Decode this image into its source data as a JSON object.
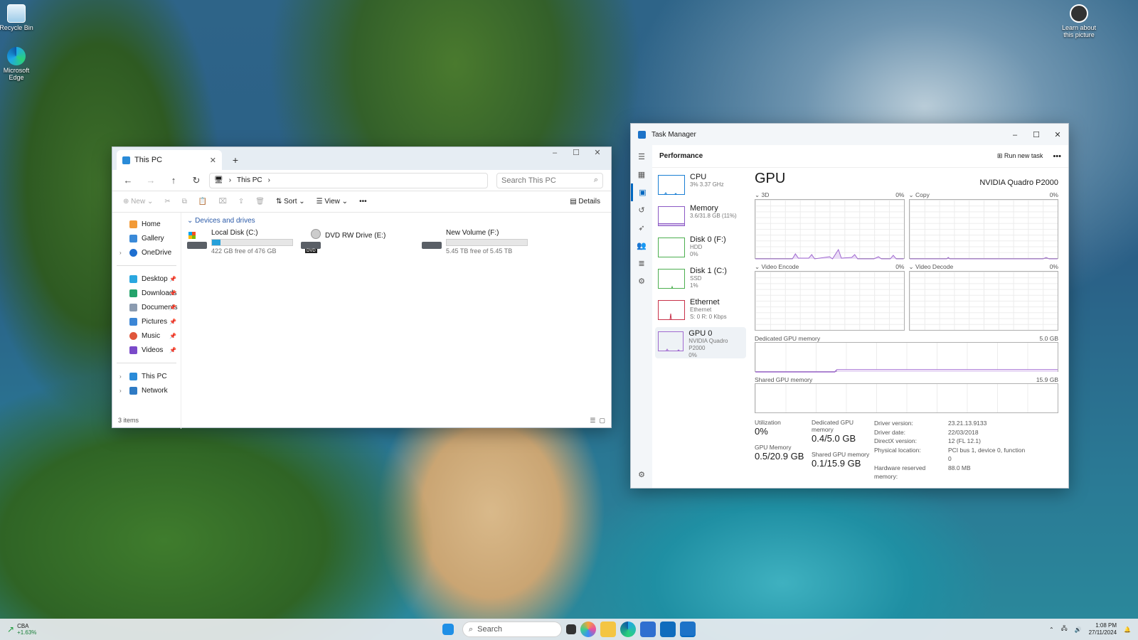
{
  "desktop": {
    "icons": [
      {
        "label": "Recycle Bin"
      },
      {
        "label": "Microsoft Edge"
      }
    ],
    "learn": {
      "label": "Learn about this picture"
    }
  },
  "explorer": {
    "tab_title": "This PC",
    "path": "This PC",
    "search_placeholder": "Search This PC",
    "cmd": {
      "new": "New",
      "sort": "Sort",
      "view": "View",
      "more": "•••",
      "details": "Details"
    },
    "nav": {
      "top": [
        "Home",
        "Gallery",
        "OneDrive"
      ],
      "quick": [
        "Desktop",
        "Downloads",
        "Documents",
        "Pictures",
        "Music",
        "Videos"
      ],
      "bottom": [
        "This PC",
        "Network"
      ]
    },
    "group": "Devices and drives",
    "drives": [
      {
        "name": "Local Disk (C:)",
        "free": "422 GB free of 476 GB",
        "used_fraction": 0.11
      },
      {
        "name": "DVD RW Drive (E:)",
        "free": "",
        "badge": "DVD"
      },
      {
        "name": "New Volume (F:)",
        "free": "5.45 TB free of 5.45 TB",
        "used_fraction": 0.0
      }
    ],
    "status": "3 items"
  },
  "taskmanager": {
    "title": "Task Manager",
    "section": "Performance",
    "run_new_task": "Run new task",
    "resources": [
      {
        "name": "CPU",
        "sub": "3% 3.37 GHz",
        "sub2": ""
      },
      {
        "name": "Memory",
        "sub": "3.6/31.8 GB (11%)",
        "sub2": ""
      },
      {
        "name": "Disk 0 (F:)",
        "sub": "HDD",
        "sub2": "0%"
      },
      {
        "name": "Disk 1 (C:)",
        "sub": "SSD",
        "sub2": "1%"
      },
      {
        "name": "Ethernet",
        "sub": "Ethernet",
        "sub2": "S: 0 R: 0 Kbps"
      },
      {
        "name": "GPU 0",
        "sub": "NVIDIA Quadro P2000",
        "sub2": "0%"
      }
    ],
    "gpu": {
      "heading": "GPU",
      "model": "NVIDIA Quadro P2000",
      "engines": [
        {
          "label": "3D",
          "pct": "0%"
        },
        {
          "label": "Copy",
          "pct": "0%"
        },
        {
          "label": "Video Encode",
          "pct": "0%"
        },
        {
          "label": "Video Decode",
          "pct": "0%"
        }
      ],
      "dedicated_label": "Dedicated GPU memory",
      "dedicated_max": "5.0 GB",
      "shared_label": "Shared GPU memory",
      "shared_max": "15.9 GB",
      "stats": {
        "utilization_label": "Utilization",
        "utilization": "0%",
        "dedicated_label": "Dedicated GPU memory",
        "dedicated": "0.4/5.0 GB",
        "gpumem_label": "GPU Memory",
        "gpumem": "0.5/20.9 GB",
        "shared_label": "Shared GPU memory",
        "shared": "0.1/15.9 GB"
      },
      "details": [
        {
          "k": "Driver version:",
          "v": "23.21.13.9133"
        },
        {
          "k": "Driver date:",
          "v": "22/03/2018"
        },
        {
          "k": "DirectX version:",
          "v": "12 (FL 12.1)"
        },
        {
          "k": "Physical location:",
          "v": "PCI bus 1, device 0, function 0"
        },
        {
          "k": "Hardware reserved memory:",
          "v": "88.0 MB"
        }
      ]
    }
  },
  "taskbar": {
    "stock_name": "CBA",
    "stock_change": "+1.63%",
    "search": "Search",
    "time": "1:08 PM",
    "date": "27/11/2024"
  }
}
